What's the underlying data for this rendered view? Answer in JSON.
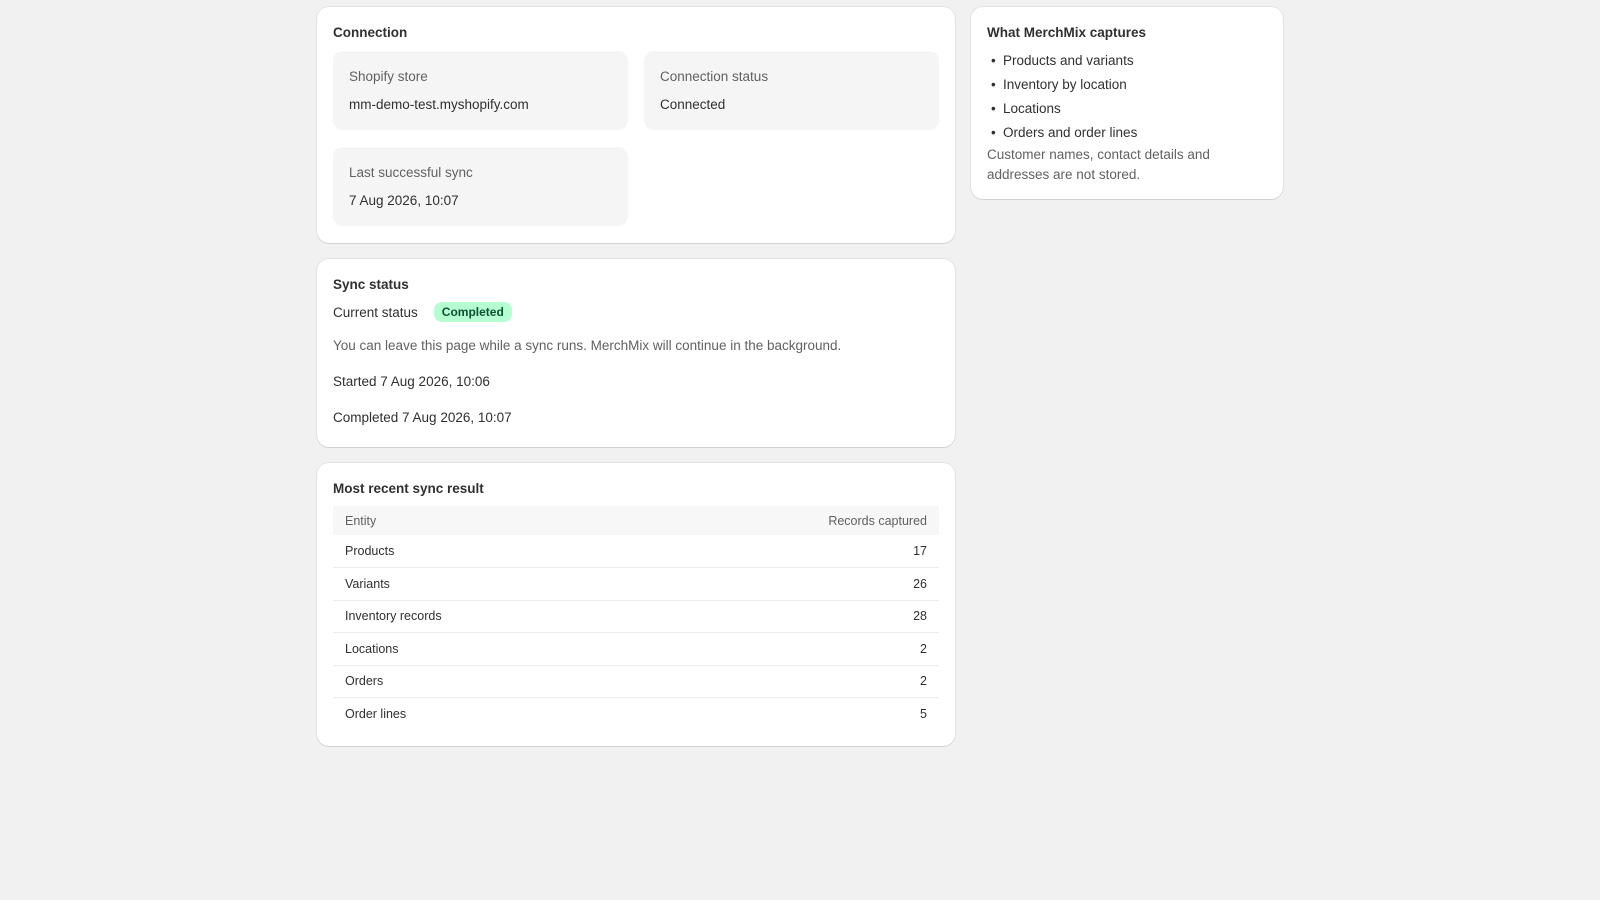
{
  "connection": {
    "title": "Connection",
    "store_label": "Shopify store",
    "store_value": "mm-demo-test.myshopify.com",
    "status_label": "Connection status",
    "status_value": "Connected",
    "sync_label": "Last successful sync",
    "sync_value": "7 Aug 2026, 10:07"
  },
  "sync_status": {
    "title": "Sync status",
    "current_label": "Current status",
    "badge": "Completed",
    "badge_color": "#b4fed2",
    "note": "You can leave this page while a sync runs. MerchMix will continue in the background.",
    "started": "Started 7 Aug 2026, 10:06",
    "completed": "Completed 7 Aug 2026, 10:07"
  },
  "result": {
    "title": "Most recent sync result",
    "columns": [
      "Entity",
      "Records captured"
    ],
    "rows": [
      {
        "entity": "Products",
        "count": "17"
      },
      {
        "entity": "Variants",
        "count": "26"
      },
      {
        "entity": "Inventory records",
        "count": "28"
      },
      {
        "entity": "Locations",
        "count": "2"
      },
      {
        "entity": "Orders",
        "count": "2"
      },
      {
        "entity": "Order lines",
        "count": "5"
      }
    ]
  },
  "captures": {
    "title": "What MerchMix captures",
    "items": [
      "Products and variants",
      "Inventory by location",
      "Locations",
      "Orders and order lines"
    ],
    "note": "Customer names, contact details and addresses are not stored."
  }
}
